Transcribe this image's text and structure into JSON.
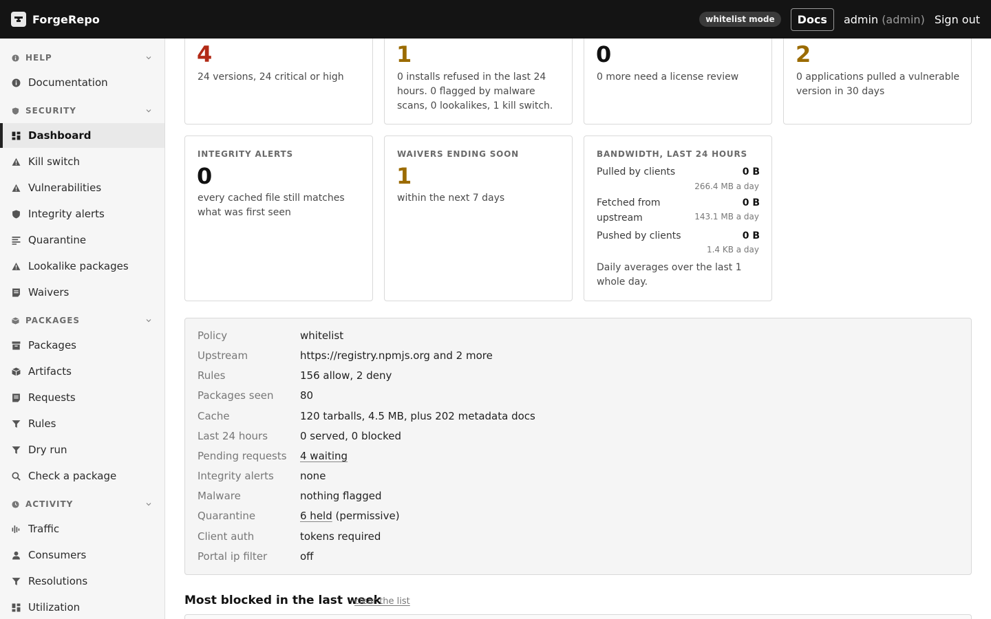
{
  "header": {
    "brand": "ForgeRepo",
    "mode_badge": "whitelist mode",
    "docs_label": "Docs",
    "user_name": "admin",
    "user_role": "(admin)",
    "signout_label": "Sign out"
  },
  "sidebar": {
    "help": {
      "title": "HELP",
      "items": [
        {
          "label": "Documentation",
          "icon": "info-icon"
        }
      ]
    },
    "security": {
      "title": "SECURITY",
      "items": [
        {
          "label": "Dashboard",
          "icon": "grid-icon",
          "active": true
        },
        {
          "label": "Kill switch",
          "icon": "warning-icon"
        },
        {
          "label": "Vulnerabilities",
          "icon": "warning-icon"
        },
        {
          "label": "Integrity alerts",
          "icon": "shield-icon"
        },
        {
          "label": "Quarantine",
          "icon": "list-icon"
        },
        {
          "label": "Lookalike packages",
          "icon": "warning-icon"
        },
        {
          "label": "Waivers",
          "icon": "note-icon"
        }
      ]
    },
    "packages": {
      "title": "PACKAGES",
      "items": [
        {
          "label": "Packages",
          "icon": "box-icon"
        },
        {
          "label": "Artifacts",
          "icon": "cube-icon"
        },
        {
          "label": "Requests",
          "icon": "note-icon"
        },
        {
          "label": "Rules",
          "icon": "filter-icon"
        },
        {
          "label": "Dry run",
          "icon": "filter-icon"
        },
        {
          "label": "Check a package",
          "icon": "search-icon"
        }
      ]
    },
    "activity": {
      "title": "ACTIVITY",
      "items": [
        {
          "label": "Traffic",
          "icon": "bars-icon"
        },
        {
          "label": "Consumers",
          "icon": "user-icon"
        },
        {
          "label": "Resolutions",
          "icon": "filter-icon"
        },
        {
          "label": "Utilization",
          "icon": "grid-icon"
        }
      ]
    }
  },
  "cards_top": [
    {
      "value": "4",
      "desc": "24 versions, 24 critical or high",
      "color": "#b22a16"
    },
    {
      "value": "1",
      "desc": "0 installs refused in the last 24 hours. 0 flagged by malware scans, 0 lookalikes, 1 kill switch.",
      "color": "#9b6b00"
    },
    {
      "value": "0",
      "desc": "0 more need a license review",
      "color": "#111111"
    },
    {
      "value": "2",
      "desc": "0 applications pulled a vulnerable version in 30 days",
      "color": "#9b6b00"
    }
  ],
  "cards_mid": [
    {
      "label": "INTEGRITY ALERTS",
      "value": "0",
      "desc": "every cached file still matches what was first seen",
      "color": "#111111"
    },
    {
      "label": "WAIVERS ENDING SOON",
      "value": "1",
      "desc": "within the next 7 days",
      "color": "#9b6b00"
    }
  ],
  "bandwidth": {
    "label": "BANDWIDTH, LAST 24 HOURS",
    "rows": [
      {
        "name": "Pulled by clients",
        "value": "0 B",
        "avg": "266.4 MB a day"
      },
      {
        "name": "Fetched from upstream",
        "value": "0 B",
        "avg": "143.1 MB a day"
      },
      {
        "name": "Pushed by clients",
        "value": "0 B",
        "avg": "1.4 KB a day"
      }
    ],
    "note": "Daily averages over the last 1 whole day."
  },
  "summary": [
    {
      "key": "Policy",
      "value": "whitelist"
    },
    {
      "key": "Upstream",
      "value": "https://registry.npmjs.org and 2 more"
    },
    {
      "key": "Rules",
      "value": "156 allow, 2 deny"
    },
    {
      "key": "Packages seen",
      "value": "80"
    },
    {
      "key": "Cache",
      "value": "120 tarballs, 4.5 MB, plus 202 metadata docs"
    },
    {
      "key": "Last 24 hours",
      "value": "0 served, 0 blocked"
    },
    {
      "key": "Pending requests",
      "link": "4 waiting"
    },
    {
      "key": "Integrity alerts",
      "value": "none"
    },
    {
      "key": "Malware",
      "value": "nothing flagged"
    },
    {
      "key": "Quarantine",
      "link": "6 held",
      "suffix": " (permissive)"
    },
    {
      "key": "Client auth",
      "value": "tokens required"
    },
    {
      "key": "Portal ip filter",
      "value": "off"
    }
  ],
  "most_blocked": {
    "title": "Most blocked in the last week",
    "clear_label": "clear the list"
  }
}
